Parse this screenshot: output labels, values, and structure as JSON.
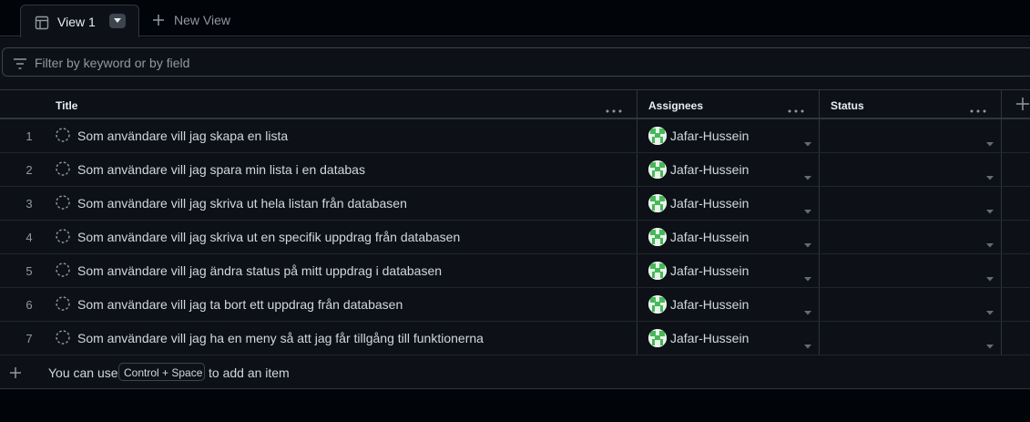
{
  "tabs": {
    "active_label": "View 1",
    "new_view_label": "New View"
  },
  "filter": {
    "placeholder": "Filter by keyword or by field"
  },
  "table": {
    "columns": [
      "Title",
      "Assignees",
      "Status"
    ],
    "rows": [
      {
        "num": "1",
        "title": "Som användare vill jag skapa en lista",
        "assignee": "Jafar-Hussein",
        "status": ""
      },
      {
        "num": "2",
        "title": "Som användare vill jag spara min lista i en databas",
        "assignee": "Jafar-Hussein",
        "status": ""
      },
      {
        "num": "3",
        "title": "Som användare vill jag skriva ut hela listan från databasen",
        "assignee": "Jafar-Hussein",
        "status": ""
      },
      {
        "num": "4",
        "title": "Som användare vill jag skriva ut en specifik uppdrag från databasen",
        "assignee": "Jafar-Hussein",
        "status": ""
      },
      {
        "num": "5",
        "title": "Som användare vill jag ändra status på mitt uppdrag i databasen",
        "assignee": "Jafar-Hussein",
        "status": ""
      },
      {
        "num": "6",
        "title": "Som användare vill jag ta bort ett uppdrag från databasen",
        "assignee": "Jafar-Hussein",
        "status": ""
      },
      {
        "num": "7",
        "title": "Som användare vill jag ha en meny så att jag får tillgång till funktionerna",
        "assignee": "Jafar-Hussein",
        "status": ""
      }
    ]
  },
  "footer": {
    "prefix": "You can use",
    "shortcut": "Control + Space",
    "suffix": "to add an item"
  },
  "colors": {
    "background": "#0d1117",
    "border": "#30363d",
    "muted_text": "#9198a1",
    "avatar_green": "#46b85a"
  }
}
